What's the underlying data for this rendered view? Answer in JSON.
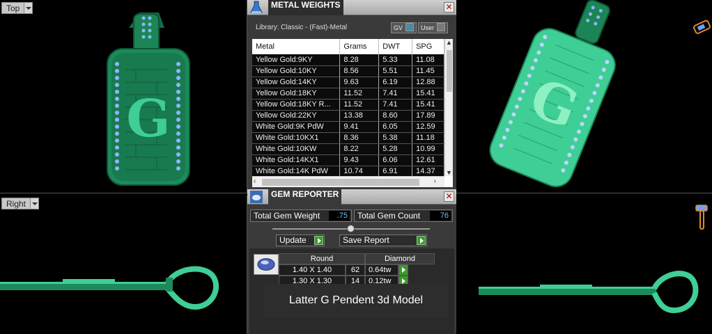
{
  "viewports": {
    "top": {
      "label": "Top"
    },
    "right": {
      "label": "Right"
    }
  },
  "model": {
    "letter": "G",
    "colors": {
      "metal": "#1c8a5a",
      "metal_light": "#3fce95",
      "gem": "#8fb6ff"
    }
  },
  "metal_weights": {
    "title": "METAL WEIGHTS",
    "library": "Library: Classic - (Fast)-Metal",
    "toggle_gv": "GV",
    "toggle_user": "User",
    "columns": [
      "Metal",
      "Grams",
      "DWT",
      "SPG"
    ],
    "rows": [
      [
        "Yellow Gold:9KY",
        "8.28",
        "5.33",
        "11.08"
      ],
      [
        "Yellow Gold:10KY",
        "8.56",
        "5.51",
        "11.45"
      ],
      [
        "Yellow Gold:14KY",
        "9.63",
        "6.19",
        "12.88"
      ],
      [
        "Yellow Gold:18KY",
        "11.52",
        "7.41",
        "15.41"
      ],
      [
        "Yellow Gold:18KY R...",
        "11.52",
        "7.41",
        "15.41"
      ],
      [
        "Yellow Gold:22KY",
        "13.38",
        "8.60",
        "17.89"
      ],
      [
        "White Gold:9K PdW",
        "9.41",
        "6.05",
        "12.59"
      ],
      [
        "White Gold:10KX1",
        "8.36",
        "5.38",
        "11.18"
      ],
      [
        "White Gold:10KW",
        "8.22",
        "5.28",
        "10.99"
      ],
      [
        "White Gold:14KX1",
        "9.43",
        "6.06",
        "12.61"
      ],
      [
        "White Gold:14K PdW",
        "10.74",
        "6.91",
        "14.37"
      ]
    ]
  },
  "gem_reporter": {
    "title": "GEM REPORTER",
    "total_weight_label": "Total Gem Weight",
    "total_weight_value": ".75",
    "total_count_label": "Total Gem Count",
    "total_count_value": "76",
    "update_label": "Update",
    "save_report_label": "Save Report",
    "gem_shape": "Round",
    "gem_type": "Diamond",
    "gems": [
      {
        "size": "1.40 X 1.40",
        "count": "62",
        "weight": "0.64tw"
      },
      {
        "size": "1.30 X 1.30",
        "count": "14",
        "weight": "0.12tw"
      }
    ]
  },
  "caption": "Latter G Pendent 3d Model"
}
